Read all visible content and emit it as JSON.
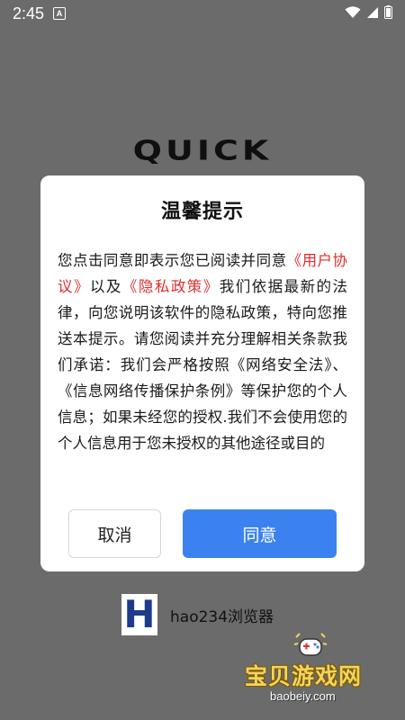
{
  "status_bar": {
    "time": "2:45",
    "notification_icon": "a-icon"
  },
  "app": {
    "logo_text": "QUICK"
  },
  "dialog": {
    "title": "温馨提示",
    "body_prefix": "您点击同意即表示您已阅读并同意",
    "user_agreement_link": "《用户协议》",
    "body_and": "以及",
    "privacy_policy_link": "《隐私政策》",
    "body_rest": "我们依据最新的法律，向您说明该软件的隐私政策，特向您推送本提示。请您阅读并充分理解相关条款我们承诺：我们会严格按照《网络安全法》、《信息网络传播保护条例》等保护您的个人信息；如果未经您的授权.我们不会使用您的个人信息用于您未授权的其他途径或目的",
    "cancel_label": "取消",
    "agree_label": "同意"
  },
  "bottom_brand": {
    "logo_letter": "H",
    "name": "hao234浏览器"
  },
  "watermark": {
    "text": "宝贝游戏网",
    "url": "baobeiy.com"
  },
  "colors": {
    "background": "#6b6b6b",
    "link": "#e02d2d",
    "agree_button": "#3b82f0",
    "h_logo": "#1e3a8a",
    "watermark_text": "#f4d35e"
  }
}
